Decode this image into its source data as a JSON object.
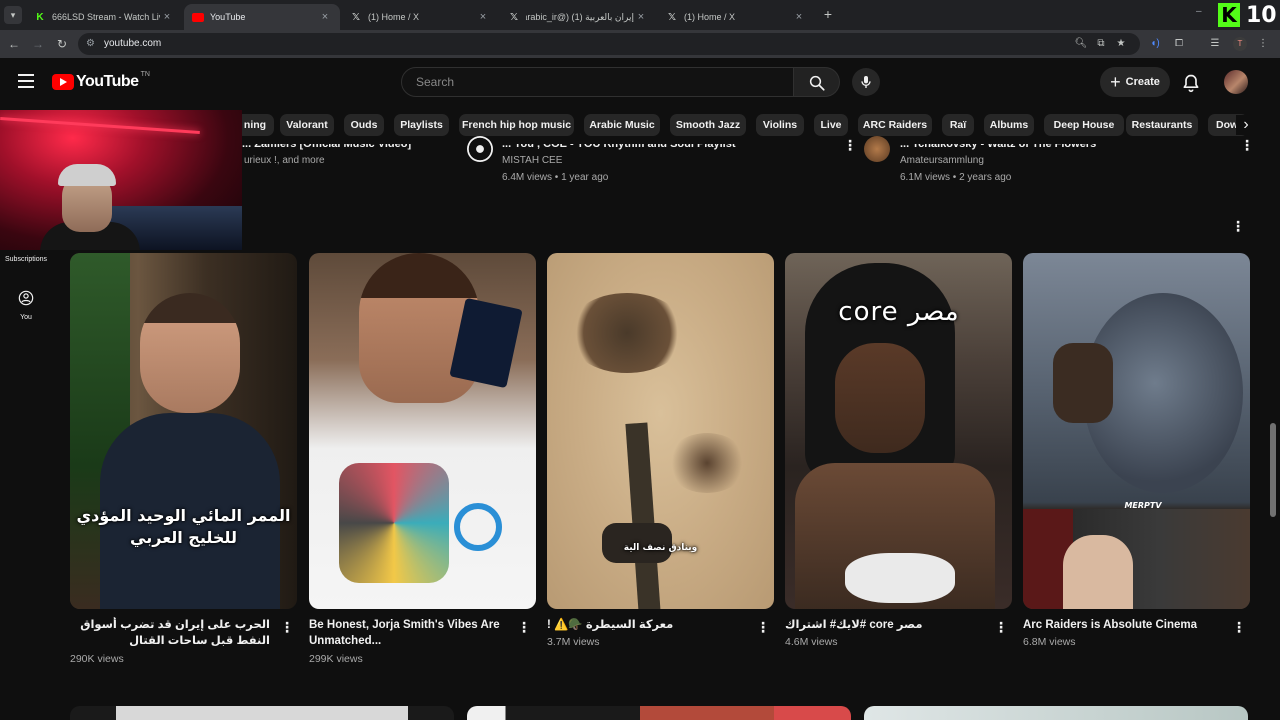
{
  "browser": {
    "tabs": [
      {
        "title": "666LSD Stream - Watch Live on",
        "favicon": "kick-icon",
        "active": false
      },
      {
        "title": "YouTube",
        "favicon": "youtube-icon",
        "active": true
      },
      {
        "title": "(1) Home / X",
        "favicon": "x-icon",
        "active": false
      },
      {
        "title": "إيران بالعربية (1) (@iraninarabic_ir)",
        "favicon": "x-icon",
        "active": false
      },
      {
        "title": "(1) Home / X",
        "favicon": "x-icon",
        "active": false
      }
    ],
    "url": "youtube.com"
  },
  "stream_overlay": {
    "brand": "K",
    "count": "10",
    "brand_color": "#53fc18"
  },
  "youtube": {
    "logo_text": "YouTube",
    "logo_tm": "TN",
    "search_placeholder": "Search",
    "create_label": "Create",
    "chips": [
      "ning",
      "Valorant",
      "Ouds",
      "Playlists",
      "French hip hop music",
      "Arabic Music",
      "Smooth Jazz",
      "Violins",
      "Live",
      "ARC Raiders",
      "Raï",
      "Albums",
      "Deep House",
      "Restaurants",
      "Dow"
    ],
    "sidebar": {
      "subscriptions_label": "Subscriptions",
      "you_label": "You"
    }
  },
  "top_row": [
    {
      "title": "... Zamiers [Official Music Video]",
      "meta": "urieux !, and more"
    },
    {
      "title": "... You , COE - YOU Rhythm and Soul Playlist",
      "channel": "MISTAH CEE",
      "meta": "6.4M views • 1 year ago"
    },
    {
      "title": "... Tchaikovsky - Waltz of The Flowers",
      "channel": "Amateursammlung",
      "meta": "6.1M views • 2 years ago"
    }
  ],
  "shorts": [
    {
      "title": "الحرب على إيران قد تضرب أسواق النفط قبل ساحات القتال",
      "views": "290K views",
      "overlay": "الممر المائي الوحيد المؤدي للخليج العربي"
    },
    {
      "title": "Be Honest, Jorja Smith's Vibes Are Unmatched...",
      "views": "299K views"
    },
    {
      "title": "معركة السيطرة 🪖⚠️ !",
      "views": "3.7M views",
      "overlay": "وبنادق نصف الية"
    },
    {
      "title": "مصر core #لايك# اشتراك",
      "views": "4.6M views",
      "overlay": "core مصر"
    },
    {
      "title": "Arc Raiders is Absolute Cinema",
      "views": "6.8M views",
      "overlay": "MERPTV"
    }
  ],
  "colors": {
    "youtube_red": "#ff0000",
    "background": "#0f0f0f",
    "chip": "#272727"
  }
}
